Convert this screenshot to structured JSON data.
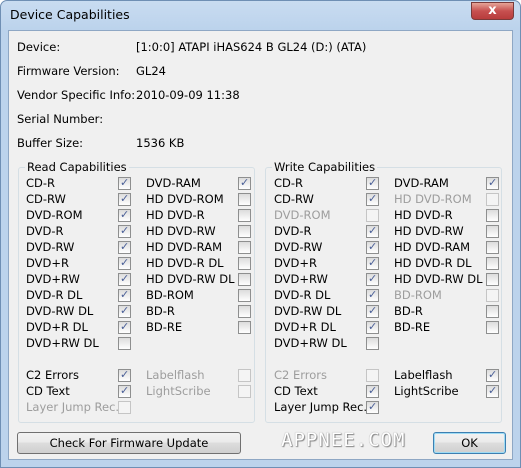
{
  "window": {
    "title": "Device Capabilities",
    "close_label": "x"
  },
  "info": [
    {
      "label": "Device:",
      "value": "[1:0:0] ATAPI iHAS624   B GL24 (D:) (ATA)"
    },
    {
      "label": "Firmware Version:",
      "value": "GL24"
    },
    {
      "label": "Vendor Specific Info:",
      "value": "2010-09-09 11:38"
    },
    {
      "label": "Serial Number:",
      "value": ""
    },
    {
      "label": "Buffer Size:",
      "value": "1536 KB"
    }
  ],
  "read": {
    "title": "Read Capabilities",
    "col1": [
      {
        "label": "CD-R",
        "checked": true,
        "enabled": true
      },
      {
        "label": "CD-RW",
        "checked": true,
        "enabled": true
      },
      {
        "label": "DVD-ROM",
        "checked": true,
        "enabled": true
      },
      {
        "label": "DVD-R",
        "checked": true,
        "enabled": true
      },
      {
        "label": "DVD-RW",
        "checked": true,
        "enabled": true
      },
      {
        "label": "DVD+R",
        "checked": true,
        "enabled": true
      },
      {
        "label": "DVD+RW",
        "checked": true,
        "enabled": true
      },
      {
        "label": "DVD-R DL",
        "checked": true,
        "enabled": true
      },
      {
        "label": "DVD-RW DL",
        "checked": true,
        "enabled": true
      },
      {
        "label": "DVD+R DL",
        "checked": true,
        "enabled": true
      },
      {
        "label": "DVD+RW DL",
        "checked": false,
        "enabled": true
      }
    ],
    "col2": [
      {
        "label": "DVD-RAM",
        "checked": true,
        "enabled": true
      },
      {
        "label": "HD DVD-ROM",
        "checked": false,
        "enabled": true
      },
      {
        "label": "HD DVD-R",
        "checked": false,
        "enabled": true
      },
      {
        "label": "HD DVD-RW",
        "checked": false,
        "enabled": true
      },
      {
        "label": "HD DVD-RAM",
        "checked": false,
        "enabled": true
      },
      {
        "label": "HD DVD-R DL",
        "checked": false,
        "enabled": true
      },
      {
        "label": "HD DVD-RW DL",
        "checked": false,
        "enabled": true
      },
      {
        "label": "BD-ROM",
        "checked": false,
        "enabled": true
      },
      {
        "label": "BD-R",
        "checked": false,
        "enabled": true
      },
      {
        "label": "BD-RE",
        "checked": false,
        "enabled": true
      }
    ],
    "extras1": [
      {
        "label": "C2 Errors",
        "checked": true,
        "enabled": true
      },
      {
        "label": "CD Text",
        "checked": true,
        "enabled": true
      },
      {
        "label": "Layer Jump Rec.",
        "checked": false,
        "enabled": false
      }
    ],
    "extras2": [
      {
        "label": "Labelflash",
        "checked": false,
        "enabled": false
      },
      {
        "label": "LightScribe",
        "checked": false,
        "enabled": false
      }
    ]
  },
  "write": {
    "title": "Write Capabilities",
    "col1": [
      {
        "label": "CD-R",
        "checked": true,
        "enabled": true
      },
      {
        "label": "CD-RW",
        "checked": true,
        "enabled": true
      },
      {
        "label": "DVD-ROM",
        "checked": false,
        "enabled": false
      },
      {
        "label": "DVD-R",
        "checked": true,
        "enabled": true
      },
      {
        "label": "DVD-RW",
        "checked": true,
        "enabled": true
      },
      {
        "label": "DVD+R",
        "checked": true,
        "enabled": true
      },
      {
        "label": "DVD+RW",
        "checked": true,
        "enabled": true
      },
      {
        "label": "DVD-R DL",
        "checked": true,
        "enabled": true
      },
      {
        "label": "DVD-RW DL",
        "checked": true,
        "enabled": true
      },
      {
        "label": "DVD+R DL",
        "checked": true,
        "enabled": true
      },
      {
        "label": "DVD+RW DL",
        "checked": false,
        "enabled": true
      }
    ],
    "col2": [
      {
        "label": "DVD-RAM",
        "checked": true,
        "enabled": true
      },
      {
        "label": "HD DVD-ROM",
        "checked": false,
        "enabled": false
      },
      {
        "label": "HD DVD-R",
        "checked": false,
        "enabled": true
      },
      {
        "label": "HD DVD-RW",
        "checked": false,
        "enabled": true
      },
      {
        "label": "HD DVD-RAM",
        "checked": false,
        "enabled": true
      },
      {
        "label": "HD DVD-R DL",
        "checked": false,
        "enabled": true
      },
      {
        "label": "HD DVD-RW DL",
        "checked": false,
        "enabled": true
      },
      {
        "label": "BD-ROM",
        "checked": false,
        "enabled": false
      },
      {
        "label": "BD-R",
        "checked": false,
        "enabled": true
      },
      {
        "label": "BD-RE",
        "checked": false,
        "enabled": true
      }
    ],
    "extras1": [
      {
        "label": "C2 Errors",
        "checked": false,
        "enabled": false
      },
      {
        "label": "CD Text",
        "checked": true,
        "enabled": true
      },
      {
        "label": "Layer Jump Rec.",
        "checked": true,
        "enabled": true
      }
    ],
    "extras2": [
      {
        "label": "Labelflash",
        "checked": true,
        "enabled": true
      },
      {
        "label": "LightScribe",
        "checked": true,
        "enabled": true
      }
    ]
  },
  "buttons": {
    "firmware": "Check For Firmware Update",
    "ok": "OK"
  },
  "watermark": "APPNEE.COM"
}
